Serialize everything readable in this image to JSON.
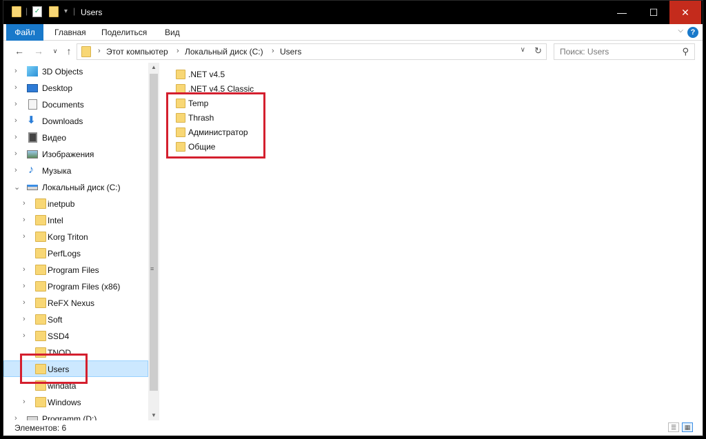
{
  "window": {
    "title": "Users",
    "buttons": {
      "minimize": "—",
      "maximize": "☐",
      "close": "✕"
    }
  },
  "ribbon": {
    "tabs": [
      "Файл",
      "Главная",
      "Поделиться",
      "Вид"
    ],
    "help": "?"
  },
  "address": {
    "crumbs": [
      "Этот компьютер",
      "Локальный диск (C:)",
      "Users"
    ]
  },
  "search": {
    "placeholder": "Поиск: Users"
  },
  "nav_tree": [
    {
      "label": "3D Objects",
      "icon": "3d-objects-icon"
    },
    {
      "label": "Desktop",
      "icon": "desktop-icon"
    },
    {
      "label": "Documents",
      "icon": "documents-icon"
    },
    {
      "label": "Downloads",
      "icon": "downloads-icon"
    },
    {
      "label": "Видео",
      "icon": "video-icon"
    },
    {
      "label": "Изображения",
      "icon": "pictures-icon"
    },
    {
      "label": "Музыка",
      "icon": "music-icon"
    },
    {
      "label": "Локальный диск (C:)",
      "icon": "drive-icon"
    },
    {
      "label": "inetpub",
      "icon": "folder-icon"
    },
    {
      "label": "Intel",
      "icon": "folder-icon"
    },
    {
      "label": "Korg Triton",
      "icon": "folder-icon"
    },
    {
      "label": "PerfLogs",
      "icon": "folder-icon"
    },
    {
      "label": "Program Files",
      "icon": "folder-icon"
    },
    {
      "label": "Program Files (x86)",
      "icon": "folder-icon"
    },
    {
      "label": "ReFX Nexus",
      "icon": "folder-icon"
    },
    {
      "label": "Soft",
      "icon": "folder-icon"
    },
    {
      "label": "SSD4",
      "icon": "folder-icon"
    },
    {
      "label": "TNOD",
      "icon": "folder-icon"
    },
    {
      "label": "Users",
      "icon": "folder-icon",
      "selected": true
    },
    {
      "label": "windata",
      "icon": "folder-icon"
    },
    {
      "label": "Windows",
      "icon": "folder-icon"
    },
    {
      "label": "Programm (D:)",
      "icon": "drive-icon"
    }
  ],
  "files": [
    ".NET v4.5",
    ".NET v4.5 Classic",
    "Temp",
    "Thrash",
    "Администратор",
    "Общие"
  ],
  "status": {
    "items": "Элементов: 6"
  },
  "colors": {
    "highlight": "#d41f2e",
    "accent": "#1979ca",
    "selection": "#cce8ff",
    "folder": "#f8d775"
  }
}
